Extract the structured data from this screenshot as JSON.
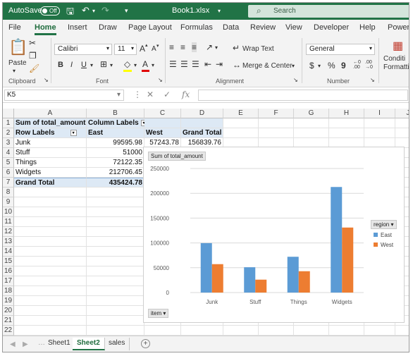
{
  "titlebar": {
    "autosave_label": "AutoSave",
    "autosave_state": "Off",
    "file_name": "Book1.xlsx",
    "search_placeholder": "Search",
    "icons": [
      "save-icon",
      "undo-icon",
      "redo-icon",
      "customize-icon",
      "search-icon"
    ]
  },
  "menu": {
    "tabs": [
      "File",
      "Home",
      "Insert",
      "Draw",
      "Page Layout",
      "Formulas",
      "Data",
      "Review",
      "View",
      "Developer",
      "Help",
      "Power"
    ],
    "active": "Home"
  },
  "ribbon": {
    "clipboard": {
      "paste_label": "Paste",
      "group_label": "Clipboard"
    },
    "font": {
      "font_name": "Calibri",
      "font_size": "11",
      "grow_label": "A",
      "shrink_label": "A",
      "bold": "B",
      "italic": "I",
      "underline": "U",
      "group_label": "Font"
    },
    "alignment": {
      "wrap_text_label": "Wrap Text",
      "merge_label": "Merge & Center",
      "group_label": "Alignment"
    },
    "number": {
      "format": "General",
      "currency": "$",
      "percent": "%",
      "comma": "9",
      "group_label": "Number"
    },
    "styles": {
      "conditional_label": "Conditi",
      "formatting_label": "Formattin"
    }
  },
  "formula_bar": {
    "name_box": "K5",
    "formula": ""
  },
  "grid": {
    "columns": [
      "A",
      "B",
      "C",
      "D",
      "E",
      "F",
      "G",
      "H",
      "I",
      "J"
    ],
    "rows": [
      "1",
      "2",
      "3",
      "4",
      "5",
      "6",
      "7",
      "8",
      "9",
      "10",
      "11",
      "12",
      "13",
      "14",
      "15",
      "16",
      "17",
      "18",
      "19",
      "20",
      "21",
      "22"
    ],
    "pivot": {
      "title": "Sum of total_amount",
      "column_labels": "Column Labels",
      "row_labels": "Row Labels",
      "col_east": "East",
      "col_west": "West",
      "col_total": "Grand Total",
      "rows": [
        {
          "label": "Junk",
          "east": "99595.98",
          "west": "57243.78",
          "total": "156839.76"
        },
        {
          "label": "Stuff",
          "east": "51000",
          "west": "",
          "total": ""
        },
        {
          "label": "Things",
          "east": "72122.35",
          "west": "",
          "total": ""
        },
        {
          "label": "Widgets",
          "east": "212706.45",
          "west": "",
          "total": ""
        }
      ],
      "grand_total_label": "Grand Total",
      "grand_total_east": "435424.78"
    }
  },
  "chart": {
    "value_field_button": "Sum of total_amount",
    "legend_field_button": "region",
    "axis_field_button": "item",
    "colors": {
      "East": "#5b9bd5",
      "West": "#ed7d31"
    }
  },
  "chart_data": {
    "type": "bar",
    "categories": [
      "Junk",
      "Stuff",
      "Things",
      "Widgets"
    ],
    "series": [
      {
        "name": "East",
        "values": [
          99595.98,
          51000,
          72122.35,
          212706.45
        ]
      },
      {
        "name": "West",
        "values": [
          57243.78,
          26000,
          43000,
          131000
        ]
      }
    ],
    "yticks": [
      "0",
      "50000",
      "100000",
      "150000",
      "200000",
      "250000"
    ],
    "ylim": [
      0,
      250000
    ],
    "grid": true,
    "legend": "right"
  },
  "sheets": {
    "tabs": [
      "Sheet1",
      "Sheet2",
      "sales"
    ],
    "active": "Sheet2"
  }
}
